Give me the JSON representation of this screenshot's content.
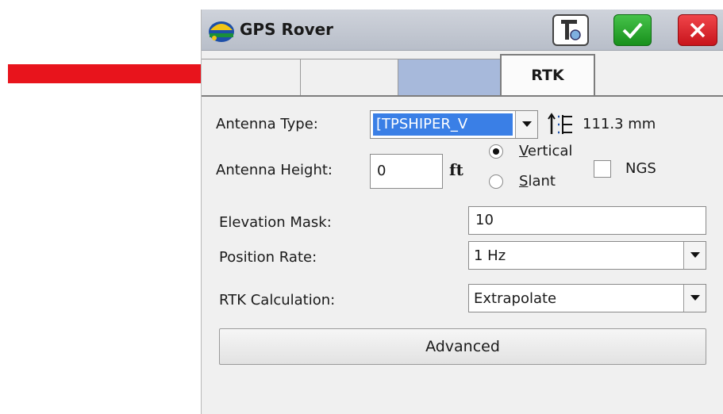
{
  "window": {
    "title": "GPS Rover"
  },
  "tabs": [
    {
      "label": ""
    },
    {
      "label": ""
    },
    {
      "label": ""
    },
    {
      "label": "RTK"
    }
  ],
  "form": {
    "antenna_type_label": "Antenna Type:",
    "antenna_type_value": "[TPSHIPER_V",
    "antenna_offset": "111.3 mm",
    "antenna_height_label": "Antenna Height:",
    "antenna_height_value": "0",
    "antenna_height_unit": "ft",
    "vertical_label": "Vertical",
    "slant_label": "Slant",
    "height_mode": "Vertical",
    "ngs_label": "NGS",
    "ngs_checked": false,
    "elevation_mask_label": "Elevation Mask:",
    "elevation_mask_value": "10",
    "position_rate_label": "Position Rate:",
    "position_rate_value": "1 Hz",
    "rtk_calc_label": "RTK Calculation:",
    "rtk_calc_value": "Extrapolate",
    "advanced_label": "Advanced"
  },
  "icons": {
    "app": "gps-rover-helmet-icon",
    "settings": "settings-icon",
    "ok": "checkmark-icon",
    "cancel": "close-icon",
    "antenna_list": "antenna-list-icon",
    "dropdown": "chevron-down-icon"
  },
  "colors": {
    "arrow": "#e8141c",
    "ok_button": "#22a327",
    "cancel_button": "#e0222a",
    "selected_tab": "#a7b9db",
    "selection": "#3a7fe6"
  }
}
